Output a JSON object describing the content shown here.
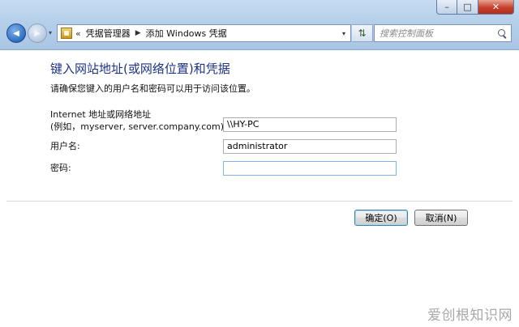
{
  "window": {
    "controls": {
      "minimize": "–",
      "maximize": "□",
      "close": "✕"
    }
  },
  "nav": {
    "back_glyph": "◀",
    "forward_glyph": "▶",
    "dropdown_glyph": "▾"
  },
  "address": {
    "prefix": "«",
    "breadcrumbs": [
      "凭据管理器",
      "添加 Windows 凭据"
    ],
    "separator": "▶",
    "dropdown_glyph": "▾",
    "refresh_glyph": "⇅"
  },
  "search": {
    "placeholder": "搜索控制面板"
  },
  "form": {
    "heading": "键入网站地址(或网络位置)和凭据",
    "intro": "请确保您键入的用户名和密码可以用于访问该位置。",
    "address_label_line1": "Internet 地址或网络地址",
    "address_label_line2": "(例如，myserver, server.company.com):",
    "address_value": "\\\\HY-PC",
    "username_label": "用户名:",
    "username_value": "administrator",
    "password_label": "密码:",
    "password_value": ""
  },
  "buttons": {
    "ok": "确定(O)",
    "cancel": "取消(N)"
  },
  "watermark": "爱创根知识网"
}
